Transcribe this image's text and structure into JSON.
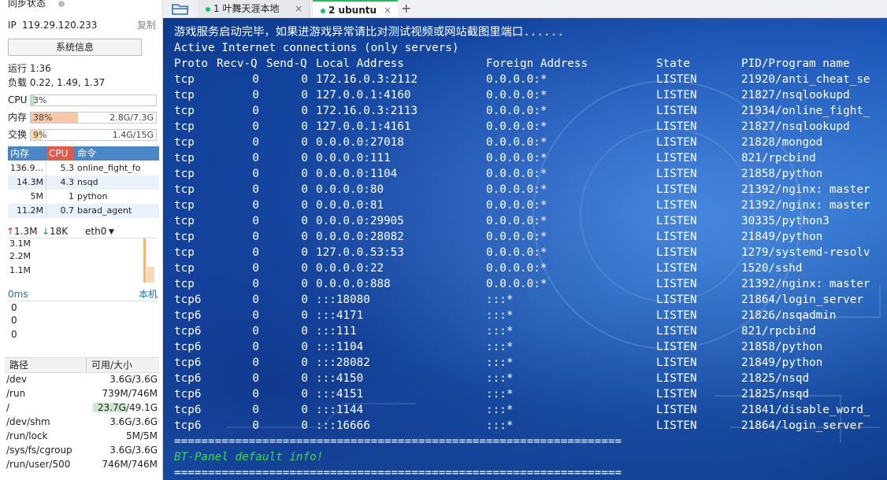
{
  "sidebar": {
    "sync_status": "同步状态",
    "ip_label": "IP",
    "ip_value": "119.29.120.233",
    "copy_label": "复制",
    "sysinfo_button": "系统信息",
    "uptime": "运行 1:36",
    "load": "负载 0.22, 1.49, 1.37",
    "cpu": {
      "label": "CPU",
      "pct": "3%",
      "fraction": 0.03
    },
    "mem": {
      "label": "内存",
      "pct": "38%",
      "value": "2.8G/7.3G",
      "fraction": 0.38
    },
    "swap": {
      "label": "交换",
      "pct": "9%",
      "value": "1.4G/15G",
      "fraction": 0.09
    },
    "proc_headers": {
      "mem": "内存",
      "cpu": "CPU",
      "cmd": "命令"
    },
    "processes": [
      {
        "mem": "136.9...",
        "cpu": "5.3",
        "cmd": "online_fight_fo"
      },
      {
        "mem": "14.3M",
        "cpu": "4.3",
        "cmd": "nsqd"
      },
      {
        "mem": "5M",
        "cpu": "1",
        "cmd": "python"
      },
      {
        "mem": "11.2M",
        "cpu": "0.7",
        "cmd": "barad_agent"
      }
    ],
    "net": {
      "up": "1.3M",
      "down": "18K",
      "iface": "eth0",
      "scale": [
        "3.1M",
        "2.2M",
        "1.1M"
      ]
    },
    "latency": {
      "value": "0ms",
      "host": "本机",
      "scale": [
        "0",
        "0",
        "0"
      ]
    },
    "disk_headers": {
      "path": "路径",
      "size": "可用/大小"
    },
    "disks": [
      {
        "path": "/dev",
        "size": "3.6G/3.6G",
        "used": 0.0
      },
      {
        "path": "/run",
        "size": "739M/746M",
        "used": 0.01
      },
      {
        "path": "/",
        "size": "23.7G/49.1G",
        "used": 0.52
      },
      {
        "path": "/dev/shm",
        "size": "3.6G/3.6G",
        "used": 0.0
      },
      {
        "path": "/run/lock",
        "size": "5M/5M",
        "used": 0.0
      },
      {
        "path": "/sys/fs/cgroup",
        "size": "3.6G/3.6G",
        "used": 0.0
      },
      {
        "path": "/run/user/500",
        "size": "746M/746M",
        "used": 0.0
      }
    ]
  },
  "tabs": [
    {
      "label": "1 叶舞天涯本地",
      "active": false
    },
    {
      "label": "2 ubuntu",
      "active": true
    }
  ],
  "add_tab_label": "+",
  "colors": {
    "accent_green": "#19c25b",
    "term_green": "#3bdc4a",
    "mem_fill": "#f8c7a4",
    "proc_header_blue": "#4a87c7",
    "proc_header_red": "#e05a4a"
  },
  "terminal": {
    "startup_msg": "游戏服务启动完毕，如果进游戏异常请比对测试视频或网站截图里端口......",
    "active_conn": "Active Internet connections (only servers)",
    "headers": {
      "proto": "Proto",
      "recvq": "Recv-Q",
      "sendq": "Send-Q",
      "local": "Local Address",
      "foreign": "Foreign Address",
      "state": "State",
      "pid": "PID/Program name"
    },
    "rows": [
      [
        "tcp",
        "0",
        "0",
        "172.16.0.3:2112",
        "0.0.0.0:*",
        "LISTEN",
        "21920/anti_cheat_se"
      ],
      [
        "tcp",
        "0",
        "0",
        "127.0.0.1:4160",
        "0.0.0.0:*",
        "LISTEN",
        "21827/nsqlookupd"
      ],
      [
        "tcp",
        "0",
        "0",
        "172.16.0.3:2113",
        "0.0.0.0:*",
        "LISTEN",
        "21934/online_fight_"
      ],
      [
        "tcp",
        "0",
        "0",
        "127.0.0.1:4161",
        "0.0.0.0:*",
        "LISTEN",
        "21827/nsqlookupd"
      ],
      [
        "tcp",
        "0",
        "0",
        "0.0.0.0:27018",
        "0.0.0.0:*",
        "LISTEN",
        "21828/mongod"
      ],
      [
        "tcp",
        "0",
        "0",
        "0.0.0.0:111",
        "0.0.0.0:*",
        "LISTEN",
        "821/rpcbind"
      ],
      [
        "tcp",
        "0",
        "0",
        "0.0.0.0:1104",
        "0.0.0.0:*",
        "LISTEN",
        "21858/python"
      ],
      [
        "tcp",
        "0",
        "0",
        "0.0.0.0:80",
        "0.0.0.0:*",
        "LISTEN",
        "21392/nginx: master"
      ],
      [
        "tcp",
        "0",
        "0",
        "0.0.0.0:81",
        "0.0.0.0:*",
        "LISTEN",
        "21392/nginx: master"
      ],
      [
        "tcp",
        "0",
        "0",
        "0.0.0.0:29905",
        "0.0.0.0:*",
        "LISTEN",
        "30335/python3"
      ],
      [
        "tcp",
        "0",
        "0",
        "0.0.0.0:28082",
        "0.0.0.0:*",
        "LISTEN",
        "21849/python"
      ],
      [
        "tcp",
        "0",
        "0",
        "127.0.0.53:53",
        "0.0.0.0:*",
        "LISTEN",
        "1279/systemd-resolv"
      ],
      [
        "tcp",
        "0",
        "0",
        "0.0.0.0:22",
        "0.0.0.0:*",
        "LISTEN",
        "1520/sshd"
      ],
      [
        "tcp",
        "0",
        "0",
        "0.0.0.0:888",
        "0.0.0.0:*",
        "LISTEN",
        "21392/nginx: master"
      ],
      [
        "tcp6",
        "0",
        "0",
        ":::18080",
        ":::*",
        "LISTEN",
        "21864/login_server"
      ],
      [
        "tcp6",
        "0",
        "0",
        ":::4171",
        ":::*",
        "LISTEN",
        "21826/nsqadmin"
      ],
      [
        "tcp6",
        "0",
        "0",
        ":::111",
        ":::*",
        "LISTEN",
        "821/rpcbind"
      ],
      [
        "tcp6",
        "0",
        "0",
        ":::1104",
        ":::*",
        "LISTEN",
        "21858/python"
      ],
      [
        "tcp6",
        "0",
        "0",
        ":::28082",
        ":::*",
        "LISTEN",
        "21849/python"
      ],
      [
        "tcp6",
        "0",
        "0",
        ":::4150",
        ":::*",
        "LISTEN",
        "21825/nsqd"
      ],
      [
        "tcp6",
        "0",
        "0",
        ":::4151",
        ":::*",
        "LISTEN",
        "21825/nsqd"
      ],
      [
        "tcp6",
        "0",
        "0",
        ":::1144",
        ":::*",
        "LISTEN",
        "21841/disable_word_"
      ],
      [
        "tcp6",
        "0",
        "0",
        ":::16666",
        ":::*",
        "LISTEN",
        "21864/login_server"
      ]
    ],
    "separator": "==================================================================",
    "bt_info": "BT-Panel default info!",
    "separator2": "=================================================================="
  }
}
